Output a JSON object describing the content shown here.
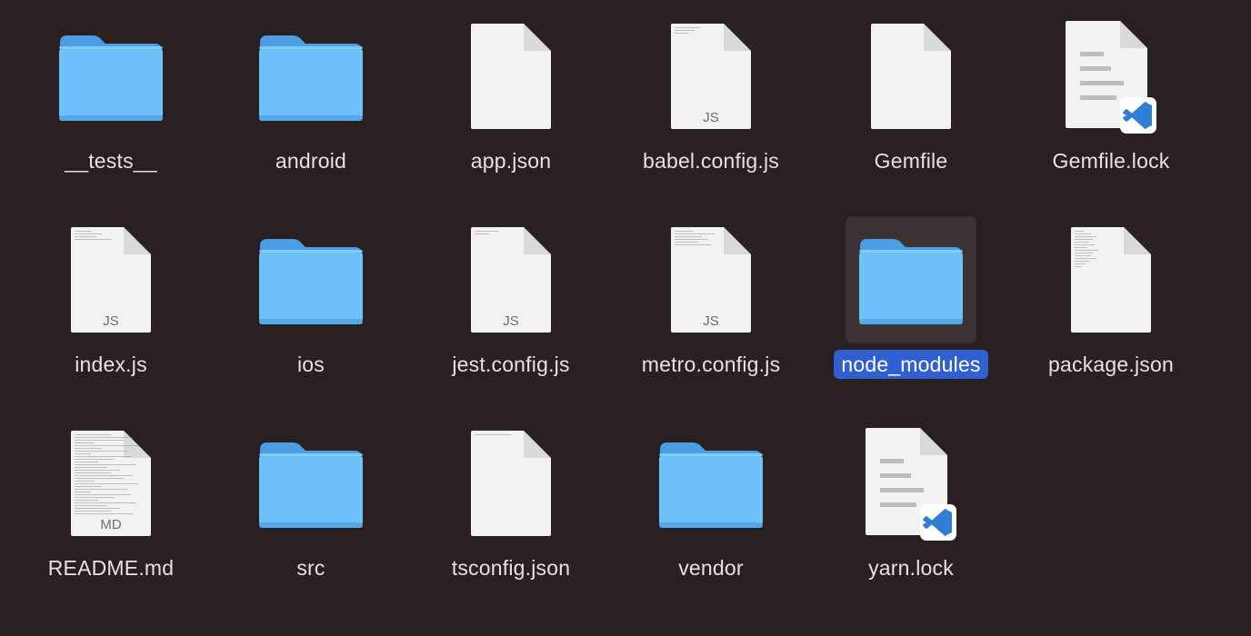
{
  "items": [
    {
      "name": "__tests__",
      "kind": "folder",
      "icon": "folder-icon"
    },
    {
      "name": "android",
      "kind": "folder",
      "icon": "folder-icon"
    },
    {
      "name": "app.json",
      "kind": "doc",
      "icon": "document-icon"
    },
    {
      "name": "babel.config.js",
      "kind": "doc",
      "icon": "js-file-icon",
      "badge": "JS"
    },
    {
      "name": "Gemfile",
      "kind": "doc",
      "icon": "document-icon"
    },
    {
      "name": "Gemfile.lock",
      "kind": "vscode",
      "icon": "vscode-file-icon"
    },
    {
      "name": "index.js",
      "kind": "doc",
      "icon": "js-file-icon",
      "badge": "JS"
    },
    {
      "name": "ios",
      "kind": "folder",
      "icon": "folder-icon"
    },
    {
      "name": "jest.config.js",
      "kind": "doc",
      "icon": "js-file-icon",
      "badge": "JS"
    },
    {
      "name": "metro.config.js",
      "kind": "doc",
      "icon": "js-file-icon",
      "badge": "JS"
    },
    {
      "name": "node_modules",
      "kind": "folder",
      "icon": "folder-icon",
      "selected": true
    },
    {
      "name": "package.json",
      "kind": "doc",
      "icon": "document-icon"
    },
    {
      "name": "README.md",
      "kind": "doc",
      "icon": "markdown-file-icon",
      "badge": "MD"
    },
    {
      "name": "src",
      "kind": "folder",
      "icon": "folder-icon"
    },
    {
      "name": "tsconfig.json",
      "kind": "doc",
      "icon": "document-icon"
    },
    {
      "name": "vendor",
      "kind": "folder",
      "icon": "folder-icon"
    },
    {
      "name": "yarn.lock",
      "kind": "vscode",
      "icon": "vscode-file-icon"
    }
  ],
  "colors": {
    "background": "#2a2022",
    "folder": "#6ec0f8",
    "folder_tab": "#4fa3e6",
    "selection": "#2f5fd0",
    "label": "#e6e2e2",
    "vscode": "#2f7fd6"
  }
}
